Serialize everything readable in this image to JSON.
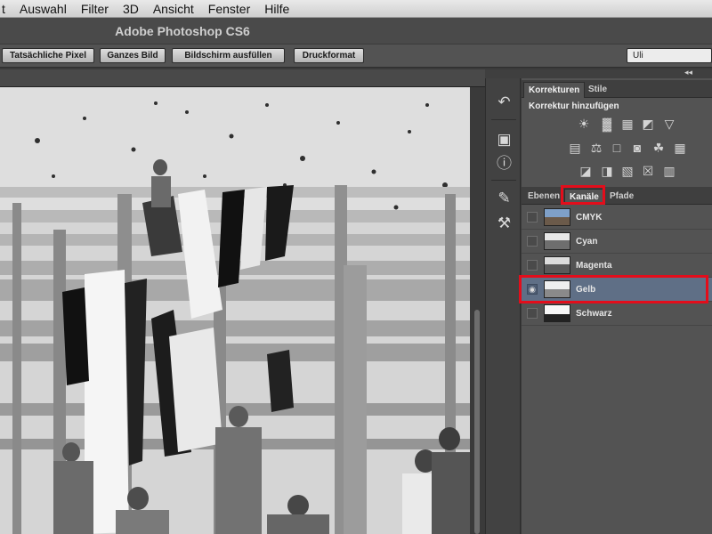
{
  "menubar": {
    "items": [
      "t",
      "Auswahl",
      "Filter",
      "3D",
      "Ansicht",
      "Fenster",
      "Hilfe"
    ]
  },
  "titlebar": {
    "title": "Adobe Photoshop CS6"
  },
  "optionsbar": {
    "buttons": [
      "Tatsächliche Pixel",
      "Ganzes Bild",
      "Bildschirm ausfüllen",
      "Druckformat"
    ],
    "workspace": "Uli"
  },
  "collapse_glyph": "◂◂",
  "toolstrip": {
    "icons": [
      "history-brush-icon",
      "camera-layer-comps-icon",
      "info-icon",
      "brush-presets-icon",
      "clone-source-icon"
    ]
  },
  "adjustments_panel": {
    "tabs": [
      "Korrekturen",
      "Stile"
    ],
    "active_tab": "Korrekturen",
    "heading": "Korrektur hinzufügen",
    "row1": [
      "brightness-icon",
      "levels-icon",
      "curves-icon",
      "exposure-icon",
      "vibrance-icon"
    ],
    "row2": [
      "hue-saturation-icon",
      "color-balance-icon",
      "black-white-icon",
      "photo-filter-icon",
      "channel-mixer-icon",
      "color-lookup-icon"
    ],
    "row3": [
      "invert-icon",
      "posterize-icon",
      "threshold-icon",
      "selective-color-icon",
      "gradient-map-icon"
    ]
  },
  "layers_panel": {
    "tabs": [
      "Ebenen",
      "Kanäle",
      "Pfade"
    ],
    "active_tab": "Kanäle",
    "channels": [
      {
        "name": "CMYK",
        "visible": false,
        "selected": false
      },
      {
        "name": "Cyan",
        "visible": false,
        "selected": false
      },
      {
        "name": "Magenta",
        "visible": false,
        "selected": false
      },
      {
        "name": "Gelb",
        "visible": true,
        "selected": true
      },
      {
        "name": "Schwarz",
        "visible": false,
        "selected": false
      }
    ]
  },
  "colors": {
    "highlight_red": "#e30d1b",
    "selected_row": "#5f6f86",
    "panel_bg": "#535353"
  }
}
